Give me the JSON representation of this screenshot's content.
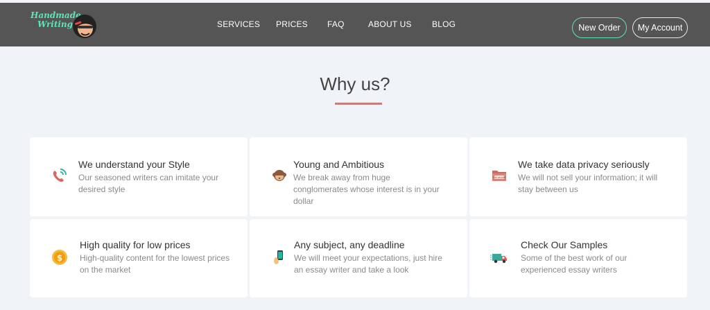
{
  "brand": {
    "line1": "Handmade",
    "line2": "Writing"
  },
  "nav": {
    "services": "SERVICES",
    "prices": "PRICES",
    "faq": "FAQ",
    "about": "ABOUT US",
    "blog": "BLOG"
  },
  "buttons": {
    "new_order": "New Order",
    "my_account": "My Account"
  },
  "section": {
    "title": "Why us?"
  },
  "features": [
    {
      "icon": "phone-icon",
      "heading": "We understand your Style",
      "text": "Our seasoned writers can imitate your desired style"
    },
    {
      "icon": "monkey-icon",
      "heading": "Young and Ambitious",
      "text": "We break away from huge conglomerates whose interest is in your dollar"
    },
    {
      "icon": "top-secret-folder-icon",
      "heading": "We take data privacy seriously",
      "text": "We will not sell your information; it will stay between us"
    },
    {
      "icon": "coin-icon",
      "heading": "High quality for low prices",
      "text": "High-quality content for the lowest prices on the market"
    },
    {
      "icon": "phone-hand-icon",
      "heading": "Any subject, any deadline",
      "text": "We will meet your expectations, just hire an essay writer and take a look"
    },
    {
      "icon": "delivery-truck-icon",
      "heading": "Check Our Samples",
      "text": "Some of the best work of our experienced essay writers"
    }
  ],
  "icon_labels": {
    "top_secret": "TOP SECRET"
  },
  "colors": {
    "header": "#555555",
    "accent": "#5ee3b6",
    "underline": "#c77d78",
    "background": "#f0f3f7"
  }
}
